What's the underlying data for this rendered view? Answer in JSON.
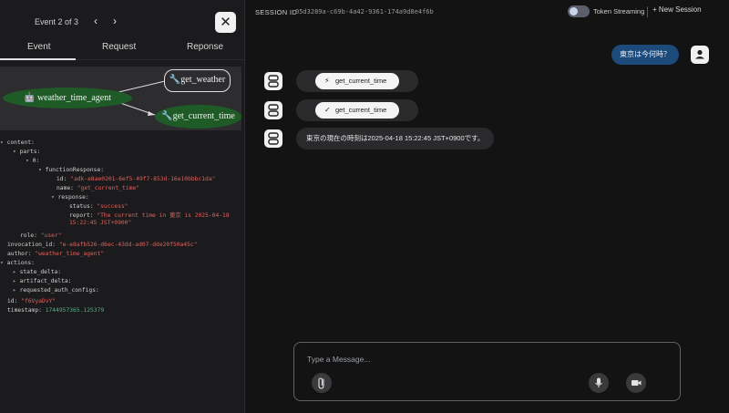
{
  "event_panel": {
    "counter": "Event 2 of 3",
    "prev_glyph": "‹",
    "next_glyph": "›",
    "close_glyph": "✕",
    "tabs": [
      "Event",
      "Request",
      "Reponse"
    ],
    "active_tab": "Event"
  },
  "graph": {
    "main_node": "weather_time_agent",
    "tool_weather": "get_weather",
    "tool_time": "get_current_time",
    "colors": {
      "active_node": "#1e5b26",
      "background": "#2d2d30"
    }
  },
  "event_json": {
    "content_key": "content:",
    "parts_key": "parts:",
    "index_key": "0:",
    "function_response_key": "functionResponse:",
    "id_key": "id:",
    "id_value": "\"adk-e8ae0201-6ef5-49f7-853d-16e10bbbc1da\"",
    "name_key": "name:",
    "name_value": "\"get_current_time\"",
    "response_key": "response:",
    "status_key": "status:",
    "status_value": "\"success\"",
    "report_key": "report:",
    "report_value_line1": "\"The current time in 東京 is 2025-04-18",
    "report_value_line2": "15:22:45 JST+0900\"",
    "role_key": "role:",
    "role_value": "\"user\"",
    "invocation_key": "invocation_id:",
    "invocation_value": "\"e-e8afb526-d6ec-43dd-ad07-dde20f50a45c\"",
    "author_key": "author:",
    "author_value": "\"weather_time_agent\"",
    "actions_key": "actions:",
    "state_delta_key": "state_delta:",
    "artifact_delta_key": "artifact_delta:",
    "requested_auth_key": "requested_auth_configs:",
    "event_id_key": "id:",
    "event_id_value": "\"f6VyaDvY\"",
    "timestamp_key": "timestamp:",
    "timestamp_value": "1744957365.125379"
  },
  "topbar": {
    "session_label": "SESSION ID",
    "session_id": "05d3289a-c69b-4a42-9361-174a9d8e4f6b",
    "token_streaming": "Token Streaming",
    "token_streaming_on": false,
    "new_session": "+ New Session"
  },
  "chat": {
    "user_message": "東京は今何時？",
    "function_call_label": "get_current_time",
    "function_call_icon": "⚡",
    "function_response_label": "get_current_time",
    "function_response_icon": "✓",
    "bot_answer": "東京の現在の時刻は2025-04-18 15:22:45 JST+0900です。",
    "accent_color": "#1c4a7a"
  },
  "composer": {
    "placeholder": "Type a Message..."
  }
}
